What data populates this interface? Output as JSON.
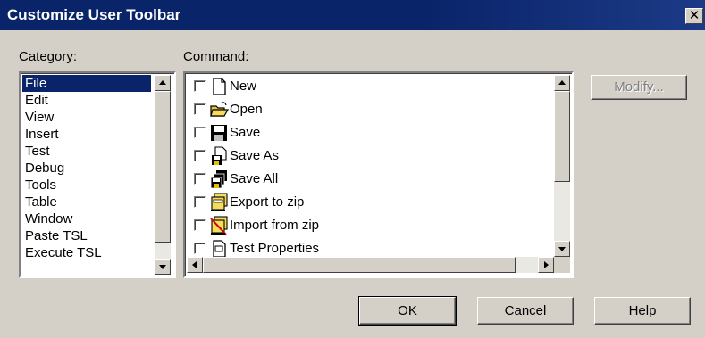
{
  "window": {
    "title": "Customize User Toolbar",
    "close_label": "✕"
  },
  "category": {
    "label": "Category:",
    "items": [
      "File",
      "Edit",
      "View",
      "Insert",
      "Test",
      "Debug",
      "Tools",
      "Table",
      "Window",
      "Paste TSL",
      "Execute TSL"
    ],
    "selected": "File"
  },
  "command": {
    "label": "Command:",
    "items": [
      {
        "label": "New",
        "icon": "new-file-icon",
        "checked": false
      },
      {
        "label": "Open",
        "icon": "open-folder-icon",
        "checked": false
      },
      {
        "label": "Save",
        "icon": "save-disk-icon",
        "checked": false
      },
      {
        "label": "Save As",
        "icon": "save-as-icon",
        "checked": false
      },
      {
        "label": "Save All",
        "icon": "save-all-icon",
        "checked": false
      },
      {
        "label": "Export to zip",
        "icon": "export-zip-icon",
        "checked": false
      },
      {
        "label": "Import from zip",
        "icon": "import-zip-icon",
        "checked": false
      },
      {
        "label": "Test Properties",
        "icon": "test-properties-icon",
        "checked": false
      }
    ]
  },
  "buttons": {
    "modify": "Modify...",
    "ok": "OK",
    "cancel": "Cancel",
    "help": "Help"
  }
}
